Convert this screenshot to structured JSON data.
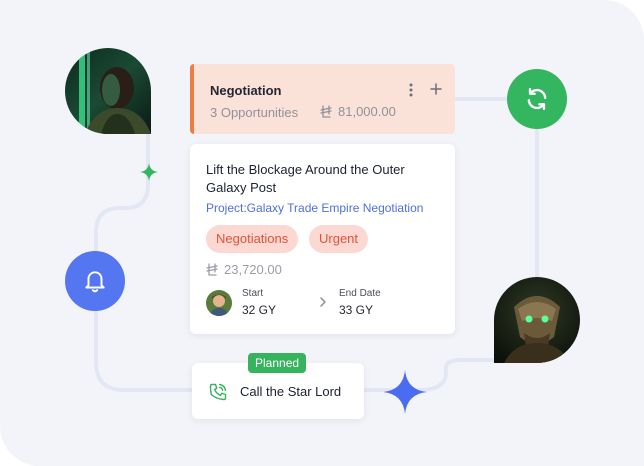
{
  "stage": {
    "title": "Negotiation",
    "count": "3 Opportunities",
    "amount": "81,000.00",
    "accent": "#f07b45"
  },
  "deal": {
    "title": "Lift the Blockage Around the Outer Galaxy Post",
    "project": "Project:Galaxy Trade Empire Negotiation",
    "tags": [
      "Negotiations",
      "Urgent"
    ],
    "amount": "23,720.00",
    "start_label": "Start",
    "start_value": "32 GY",
    "end_label": "End Date",
    "end_value": "33 GY"
  },
  "task": {
    "badge": "Planned",
    "label": "Call the Star Lord"
  },
  "icons": {
    "sync": "sync-icon",
    "bell": "bell-icon",
    "phone": "phone-call-icon",
    "menu": "kebab-menu-icon",
    "add": "plus-icon",
    "currency": "currency-icon",
    "chevron": "chevron-right-icon"
  },
  "colors": {
    "green": "#34b560",
    "blue": "#5476f0",
    "tag_bg": "#fbd9d2",
    "tag_text": "#e2523b",
    "project_link": "#4f6fe4"
  }
}
